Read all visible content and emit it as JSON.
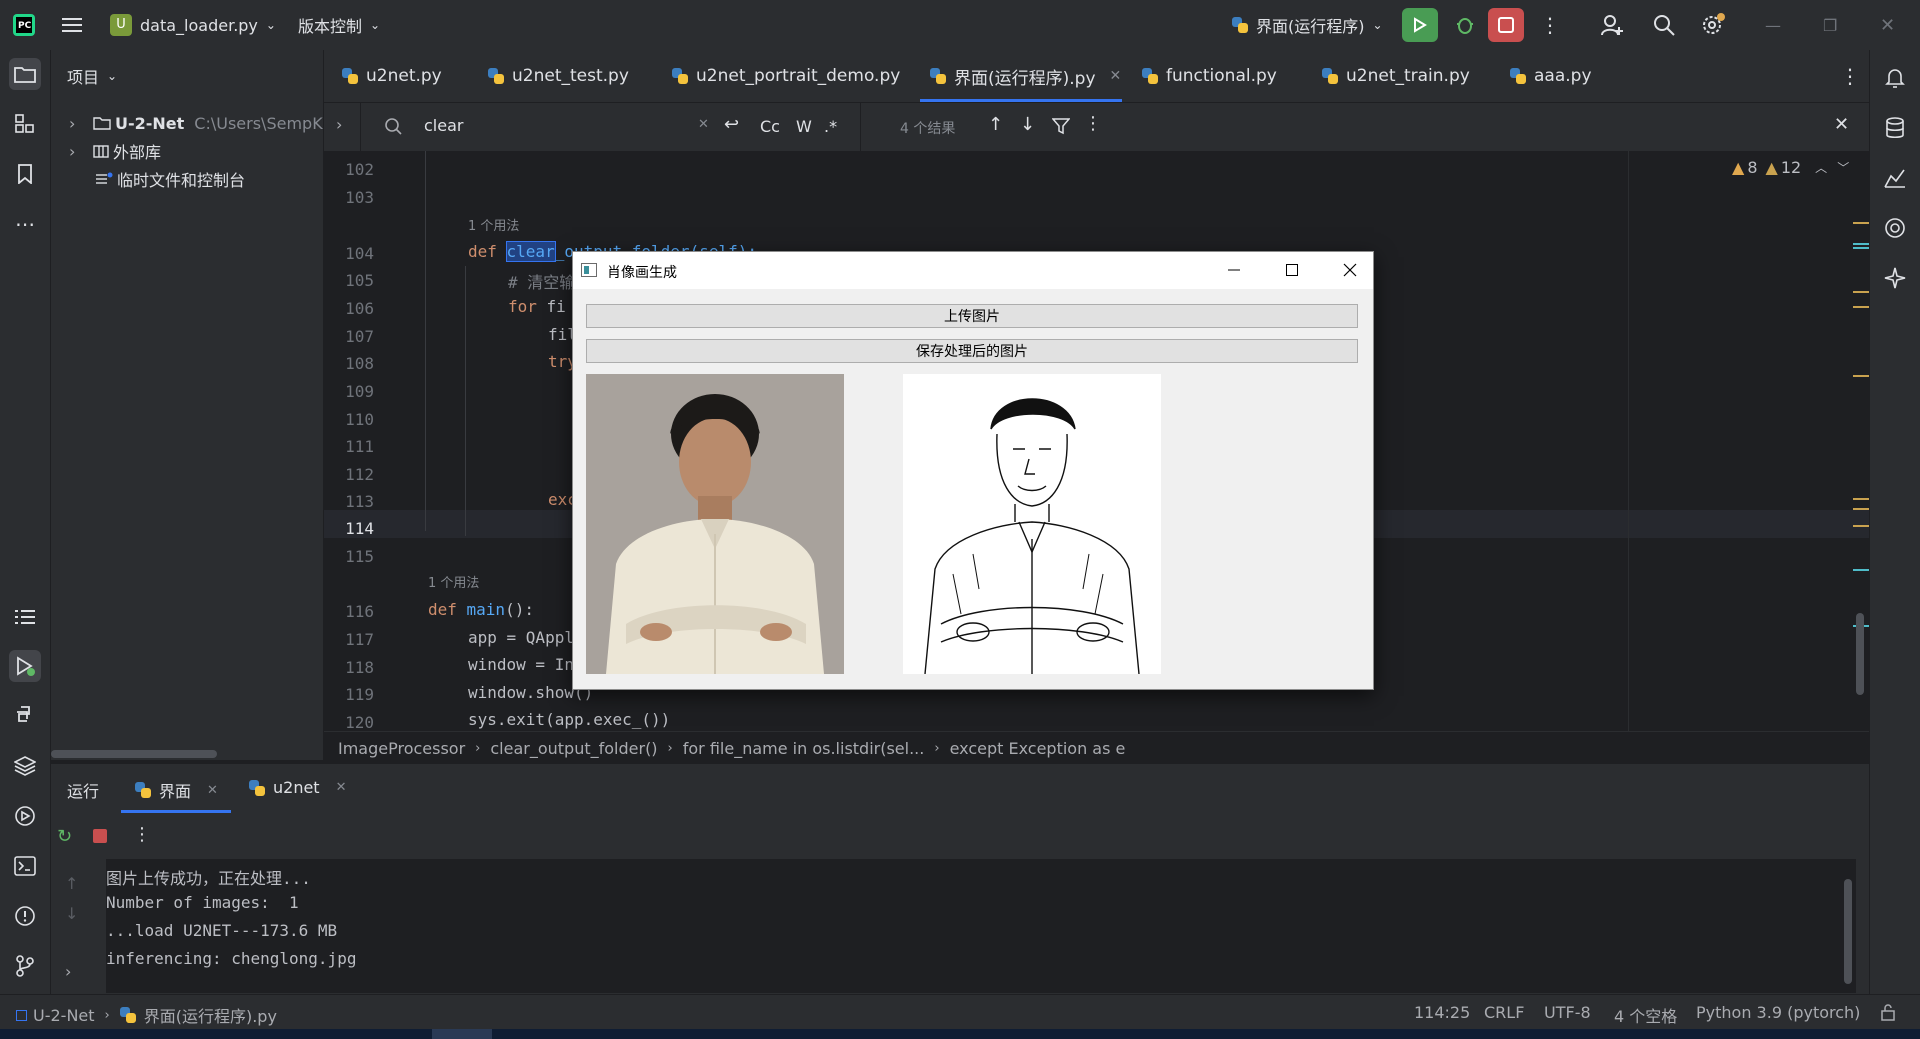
{
  "topbar": {
    "project_badge": "U",
    "file_name": "data_loader.py",
    "vcs_label": "版本控制",
    "run_config": "界面(运行程序)"
  },
  "project_panel": {
    "title": "项目",
    "root_name": "U-2-Net",
    "root_path": "C:\\Users\\SempKi",
    "external_libs": "外部库",
    "scratches": "临时文件和控制台"
  },
  "tabs": [
    {
      "label": "u2net.py"
    },
    {
      "label": "u2net_test.py"
    },
    {
      "label": "u2net_portrait_demo.py"
    },
    {
      "label": "界面(运行程序).py"
    },
    {
      "label": "functional.py"
    },
    {
      "label": "u2net_train.py"
    },
    {
      "label": "aaa.py"
    }
  ],
  "find": {
    "query": "clear",
    "case_label": "Cc",
    "word_label": "W",
    "regex_label": ".*",
    "results": "4 个结果"
  },
  "inspections": {
    "warnings": "8",
    "weak_warnings": "12"
  },
  "editor": {
    "line_numbers": [
      "102",
      "103",
      "104",
      "105",
      "106",
      "107",
      "108",
      "109",
      "110",
      "111",
      "112",
      "113",
      "114",
      "115",
      "116",
      "117",
      "118",
      "119",
      "120"
    ],
    "usage_hint_1": "1 个用法",
    "usage_hint_2": "1 个用法",
    "l104_def": "def ",
    "l104_name_hl": "clear",
    "l104_rest": "_output_folder(self):",
    "l105": "# 清空输",
    "l106_for": "for ",
    "l106_rest": "fi",
    "l107": "fil",
    "l108": "try",
    "l113": "exc",
    "l116_def": "def ",
    "l116_name": "main",
    "l116_rest": "():",
    "l117": "app = QAppl",
    "l118": "window = In",
    "l119": "window.show()",
    "l120": "sys.exit(app.exec_())"
  },
  "breadcrumb": [
    "ImageProcessor",
    "clear_output_folder()",
    "for file_name in os.listdir(sel...",
    "except Exception as e"
  ],
  "run_panel": {
    "title": "运行",
    "tab1": "界面",
    "tab2": "u2net",
    "console": [
      "图片上传成功，正在处理...",
      "Number of images:  1",
      "...load U2NET---173.6 MB",
      "inferencing: chenglong.jpg"
    ]
  },
  "statusbar": {
    "project": "U-2-Net",
    "file": "界面(运行程序).py",
    "position": "114:25",
    "line_sep": "CRLF",
    "encoding": "UTF-8",
    "indent": "4 个空格",
    "interpreter": "Python 3.9 (pytorch)"
  },
  "dialog": {
    "title": "肖像画生成",
    "upload_button": "上传图片",
    "save_button": "保存处理后的图片"
  },
  "colors": {
    "accent_blue": "#3574f0",
    "run_green": "#499c54",
    "stop_red": "#c94f4f",
    "warning_yellow": "#e0a84f"
  }
}
